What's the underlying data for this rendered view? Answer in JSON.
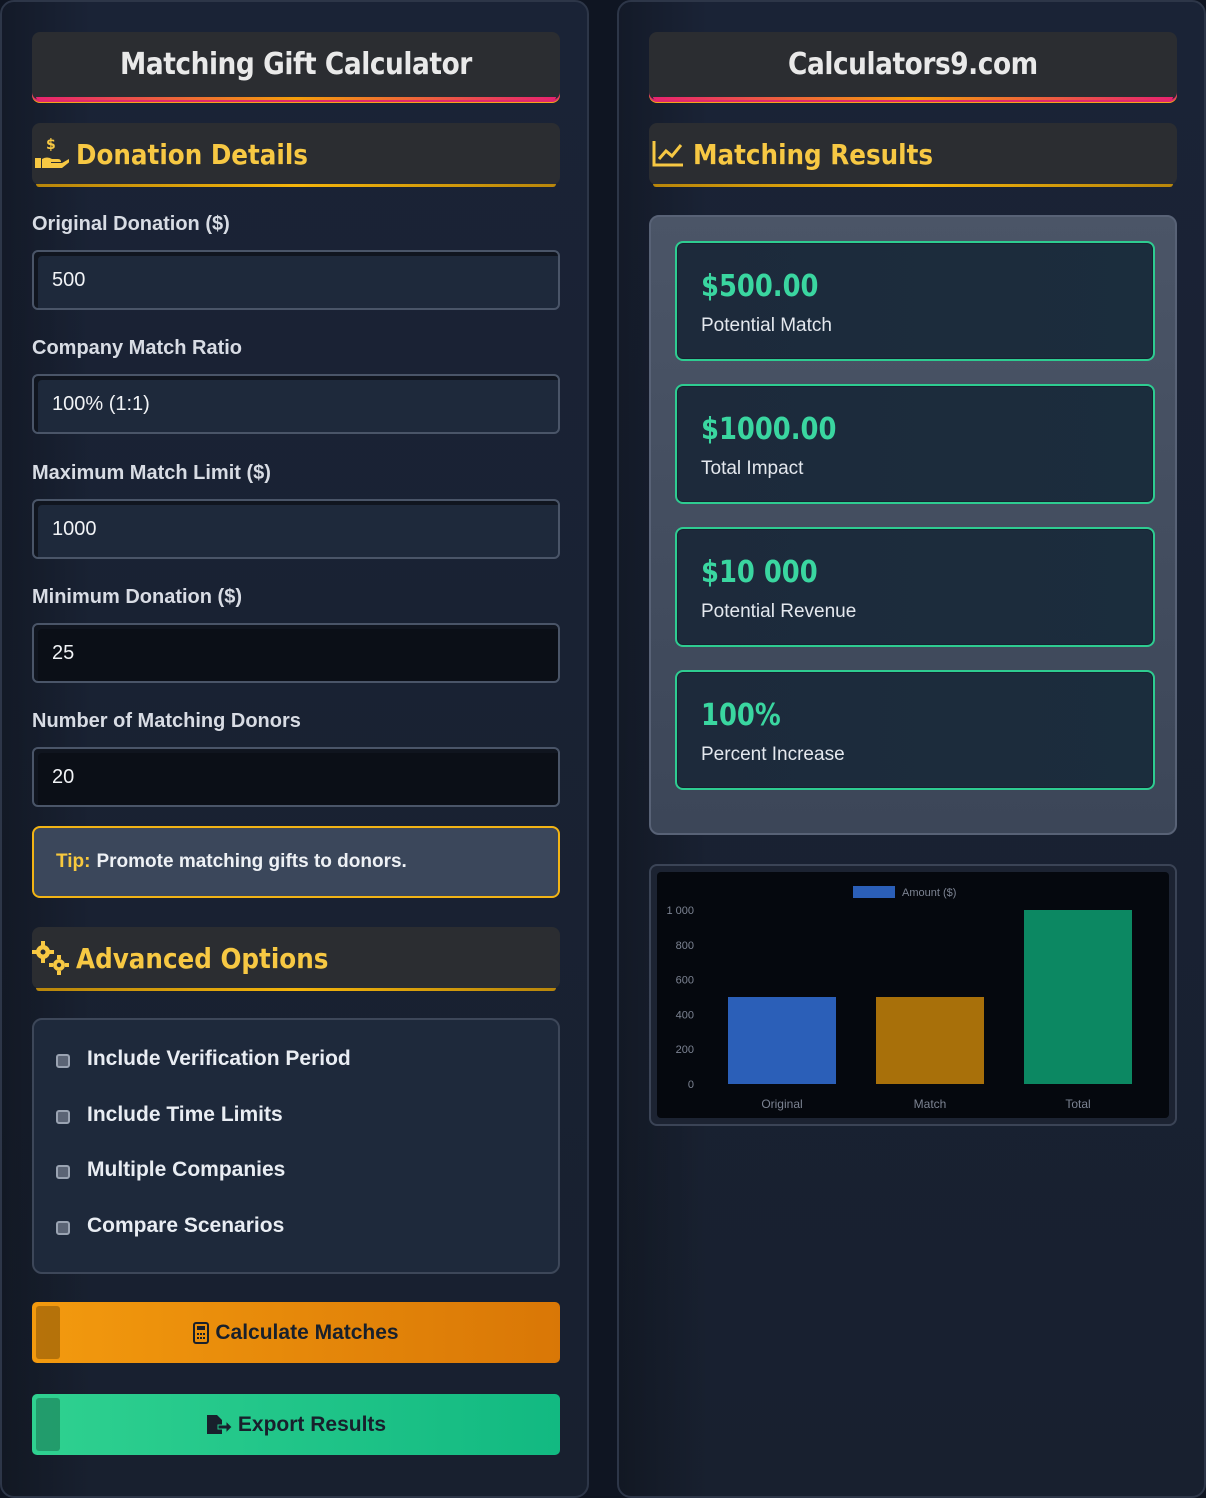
{
  "left": {
    "title": "Matching Gift Calculator",
    "section_donation": "Donation Details",
    "fields": [
      {
        "label": "Original Donation ($)",
        "value": "500"
      },
      {
        "label": "Company Match Ratio",
        "value": "100% (1:1)"
      },
      {
        "label": "Maximum Match Limit ($)",
        "value": "1000"
      },
      {
        "label": "Minimum Donation ($)",
        "value": "25"
      },
      {
        "label": "Number of Matching Donors",
        "value": "20"
      }
    ],
    "tip": {
      "key": "Tip:",
      "text": "Promote matching gifts to donors."
    },
    "section_advanced": "Advanced Options",
    "options": [
      "Include Verification Period",
      "Include Time Limits",
      "Multiple Companies",
      "Compare Scenarios"
    ],
    "calculate_label": "Calculate Matches",
    "export_label": "Export Results"
  },
  "right": {
    "title": "Calculators9.com",
    "section_results": "Matching Results",
    "metrics": [
      {
        "value": "$500.00",
        "label": "Potential Match"
      },
      {
        "value": "$1000.00",
        "label": "Total Impact"
      },
      {
        "value": "$10 000",
        "label": "Potential Revenue"
      },
      {
        "value": "100%",
        "label": "Percent Increase"
      }
    ]
  },
  "colors": {
    "accent_gold": "#f7c843",
    "metric_green": "#3ad6a0",
    "calc_orange": "#f39a0e",
    "export_green": "#12b981"
  },
  "chart_data": {
    "type": "bar",
    "legend": "Amount ($)",
    "legend_placement": "top",
    "categories": [
      "Original",
      "Match",
      "Total"
    ],
    "values": [
      500,
      500,
      1000
    ],
    "colors": [
      "#2b5fb8",
      "#a8700a",
      "#0c8862"
    ],
    "ylim": [
      0,
      1000
    ],
    "yticks": [
      "0",
      "200",
      "400",
      "600",
      "800",
      "1 000"
    ],
    "grid": false
  }
}
